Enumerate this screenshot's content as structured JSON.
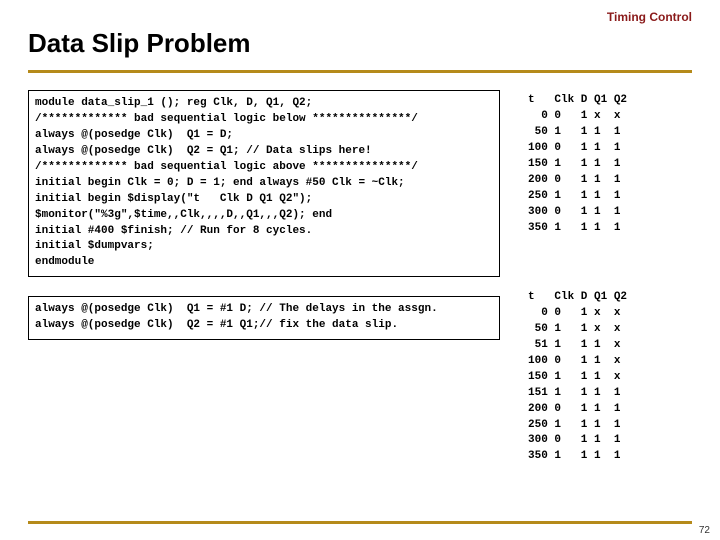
{
  "header": {
    "topic": "Timing Control",
    "title": "Data Slip Problem",
    "page_number": "72"
  },
  "code_main": "module data_slip_1 (); reg Clk, D, Q1, Q2;\n/************* bad sequential logic below ***************/\nalways @(posedge Clk)  Q1 = D;\nalways @(posedge Clk)  Q2 = Q1; // Data slips here!\n/************* bad sequential logic above ***************/\ninitial begin Clk = 0; D = 1; end always #50 Clk = ~Clk;\ninitial begin $display(\"t   Clk D Q1 Q2\");\n$monitor(\"%3g\",$time,,Clk,,,,D,,Q1,,,Q2); end\ninitial #400 $finish; // Run for 8 cycles.\ninitial $dumpvars;\nendmodule",
  "code_fix": "always @(posedge Clk)  Q1 = #1 D; // The delays in the assgn.\nalways @(posedge Clk)  Q2 = #1 Q1;// fix the data slip.",
  "output_bad": "t   Clk D Q1 Q2\n  0 0   1 x  x\n 50 1   1 1  1\n100 0   1 1  1\n150 1   1 1  1\n200 0   1 1  1\n250 1   1 1  1\n300 0   1 1  1\n350 1   1 1  1",
  "output_fixed": "t   Clk D Q1 Q2\n  0 0   1 x  x\n 50 1   1 x  x\n 51 1   1 1  x\n100 0   1 1  x\n150 1   1 1  x\n151 1   1 1  1\n200 0   1 1  1\n250 1   1 1  1\n300 0   1 1  1\n350 1   1 1  1"
}
